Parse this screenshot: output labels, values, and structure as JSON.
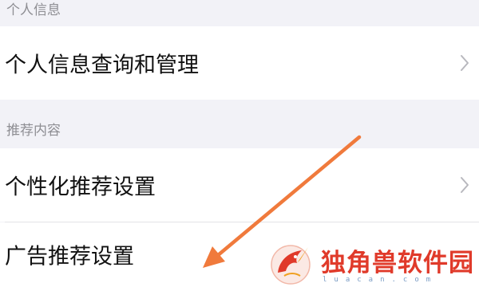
{
  "sections": [
    {
      "header": "个人信息",
      "items": [
        {
          "label": "个人信息查询和管理",
          "chevron": true
        }
      ]
    },
    {
      "header": "推荐内容",
      "items": [
        {
          "label": "个性化推荐设置",
          "chevron": true
        },
        {
          "label": "广告推荐设置",
          "chevron": false
        }
      ]
    }
  ],
  "annotation": {
    "arrow_color": "#f07a3c",
    "icon": "arrow-pointing-icon"
  },
  "watermark": {
    "brand": "独角兽软件园",
    "url": "luacan.com",
    "color": "#e03a2a",
    "icon": "unicorn-logo-icon"
  }
}
